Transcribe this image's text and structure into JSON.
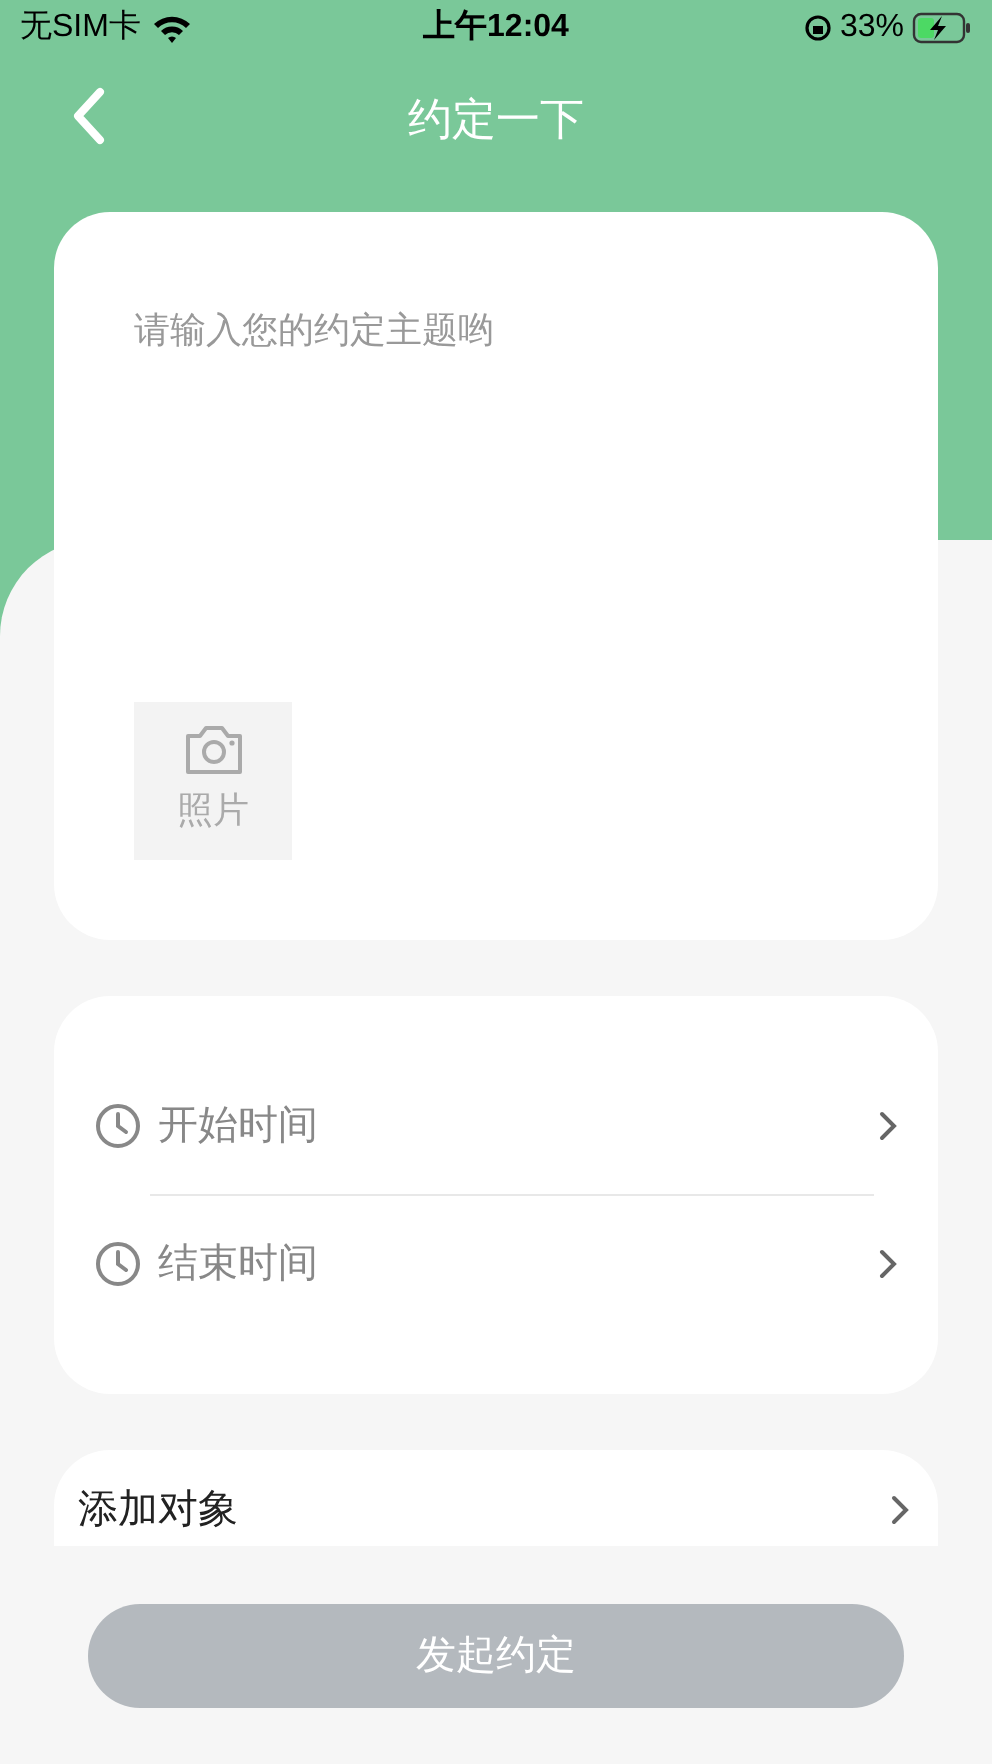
{
  "status_bar": {
    "carrier": "无SIM卡",
    "time": "上午12:04",
    "battery": "33%"
  },
  "nav": {
    "title": "约定一下"
  },
  "topic": {
    "placeholder": "请输入您的约定主题哟"
  },
  "photo_button": {
    "label": "照片"
  },
  "time_rows": [
    {
      "label": "开始时间"
    },
    {
      "label": "结束时间"
    }
  ],
  "add_target": {
    "label": "添加对象"
  },
  "submit": {
    "label": "发起约定",
    "disabled": true
  }
}
